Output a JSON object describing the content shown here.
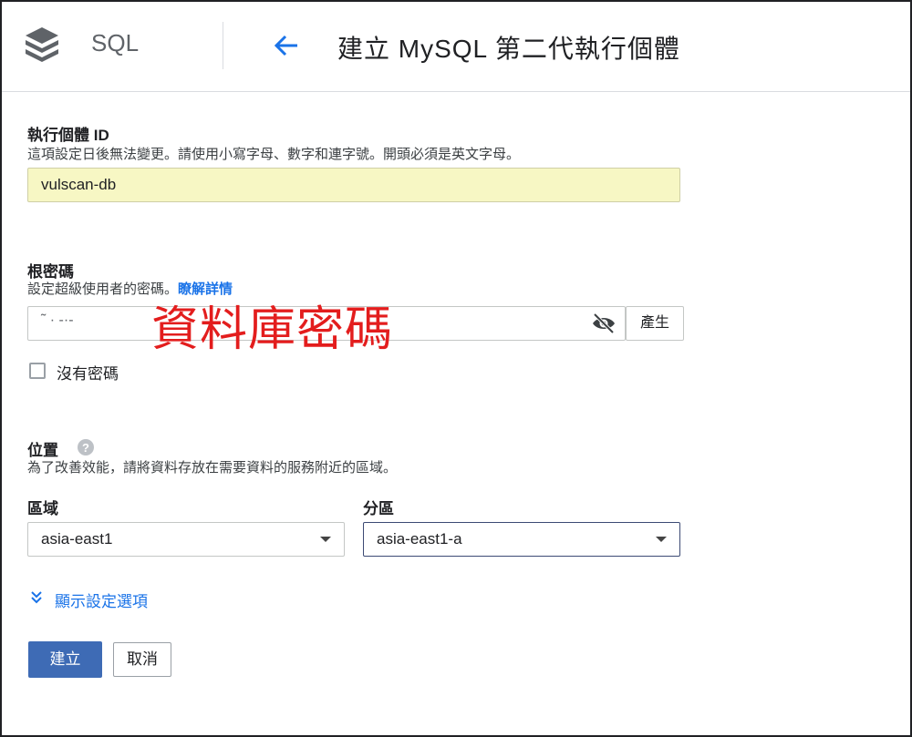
{
  "header": {
    "product": "SQL",
    "title": "建立 MySQL 第二代執行個體",
    "logo_icon": "sql-stack-logo",
    "back_icon": "arrow-left-icon",
    "accent_color": "#1a73e8"
  },
  "instance_id": {
    "label": "執行個體 ID",
    "hint": "這項設定日後無法變更。請使用小寫字母、數字和連字號。開頭必須是英文字母。",
    "value": "vulscan-db",
    "field_bg": "#f7f7c4"
  },
  "root_password": {
    "label": "根密碼",
    "hint": "設定超級使用者的密碼。",
    "link": "瞭解詳情",
    "value": "˜  ·  -·-",
    "visibility_icon": "eye-off-icon",
    "generate_button": "產生",
    "annotation": "資料庫密碼",
    "annotation_color": "#e31d1d"
  },
  "no_password": {
    "label": "沒有密碼",
    "checked": false
  },
  "location": {
    "label": "位置",
    "help_icon": "help-circle-icon",
    "hint": "為了改善效能，請將資料存放在需要資料的服務附近的區域。",
    "region": {
      "label": "區域",
      "value": "asia-east1"
    },
    "zone": {
      "label": "分區",
      "value": "asia-east1-a"
    }
  },
  "show_options": {
    "label": "顯示設定選項",
    "icon": "chevron-double-down-icon"
  },
  "actions": {
    "create": "建立",
    "cancel": "取消",
    "primary_color": "#3e6bb5"
  }
}
